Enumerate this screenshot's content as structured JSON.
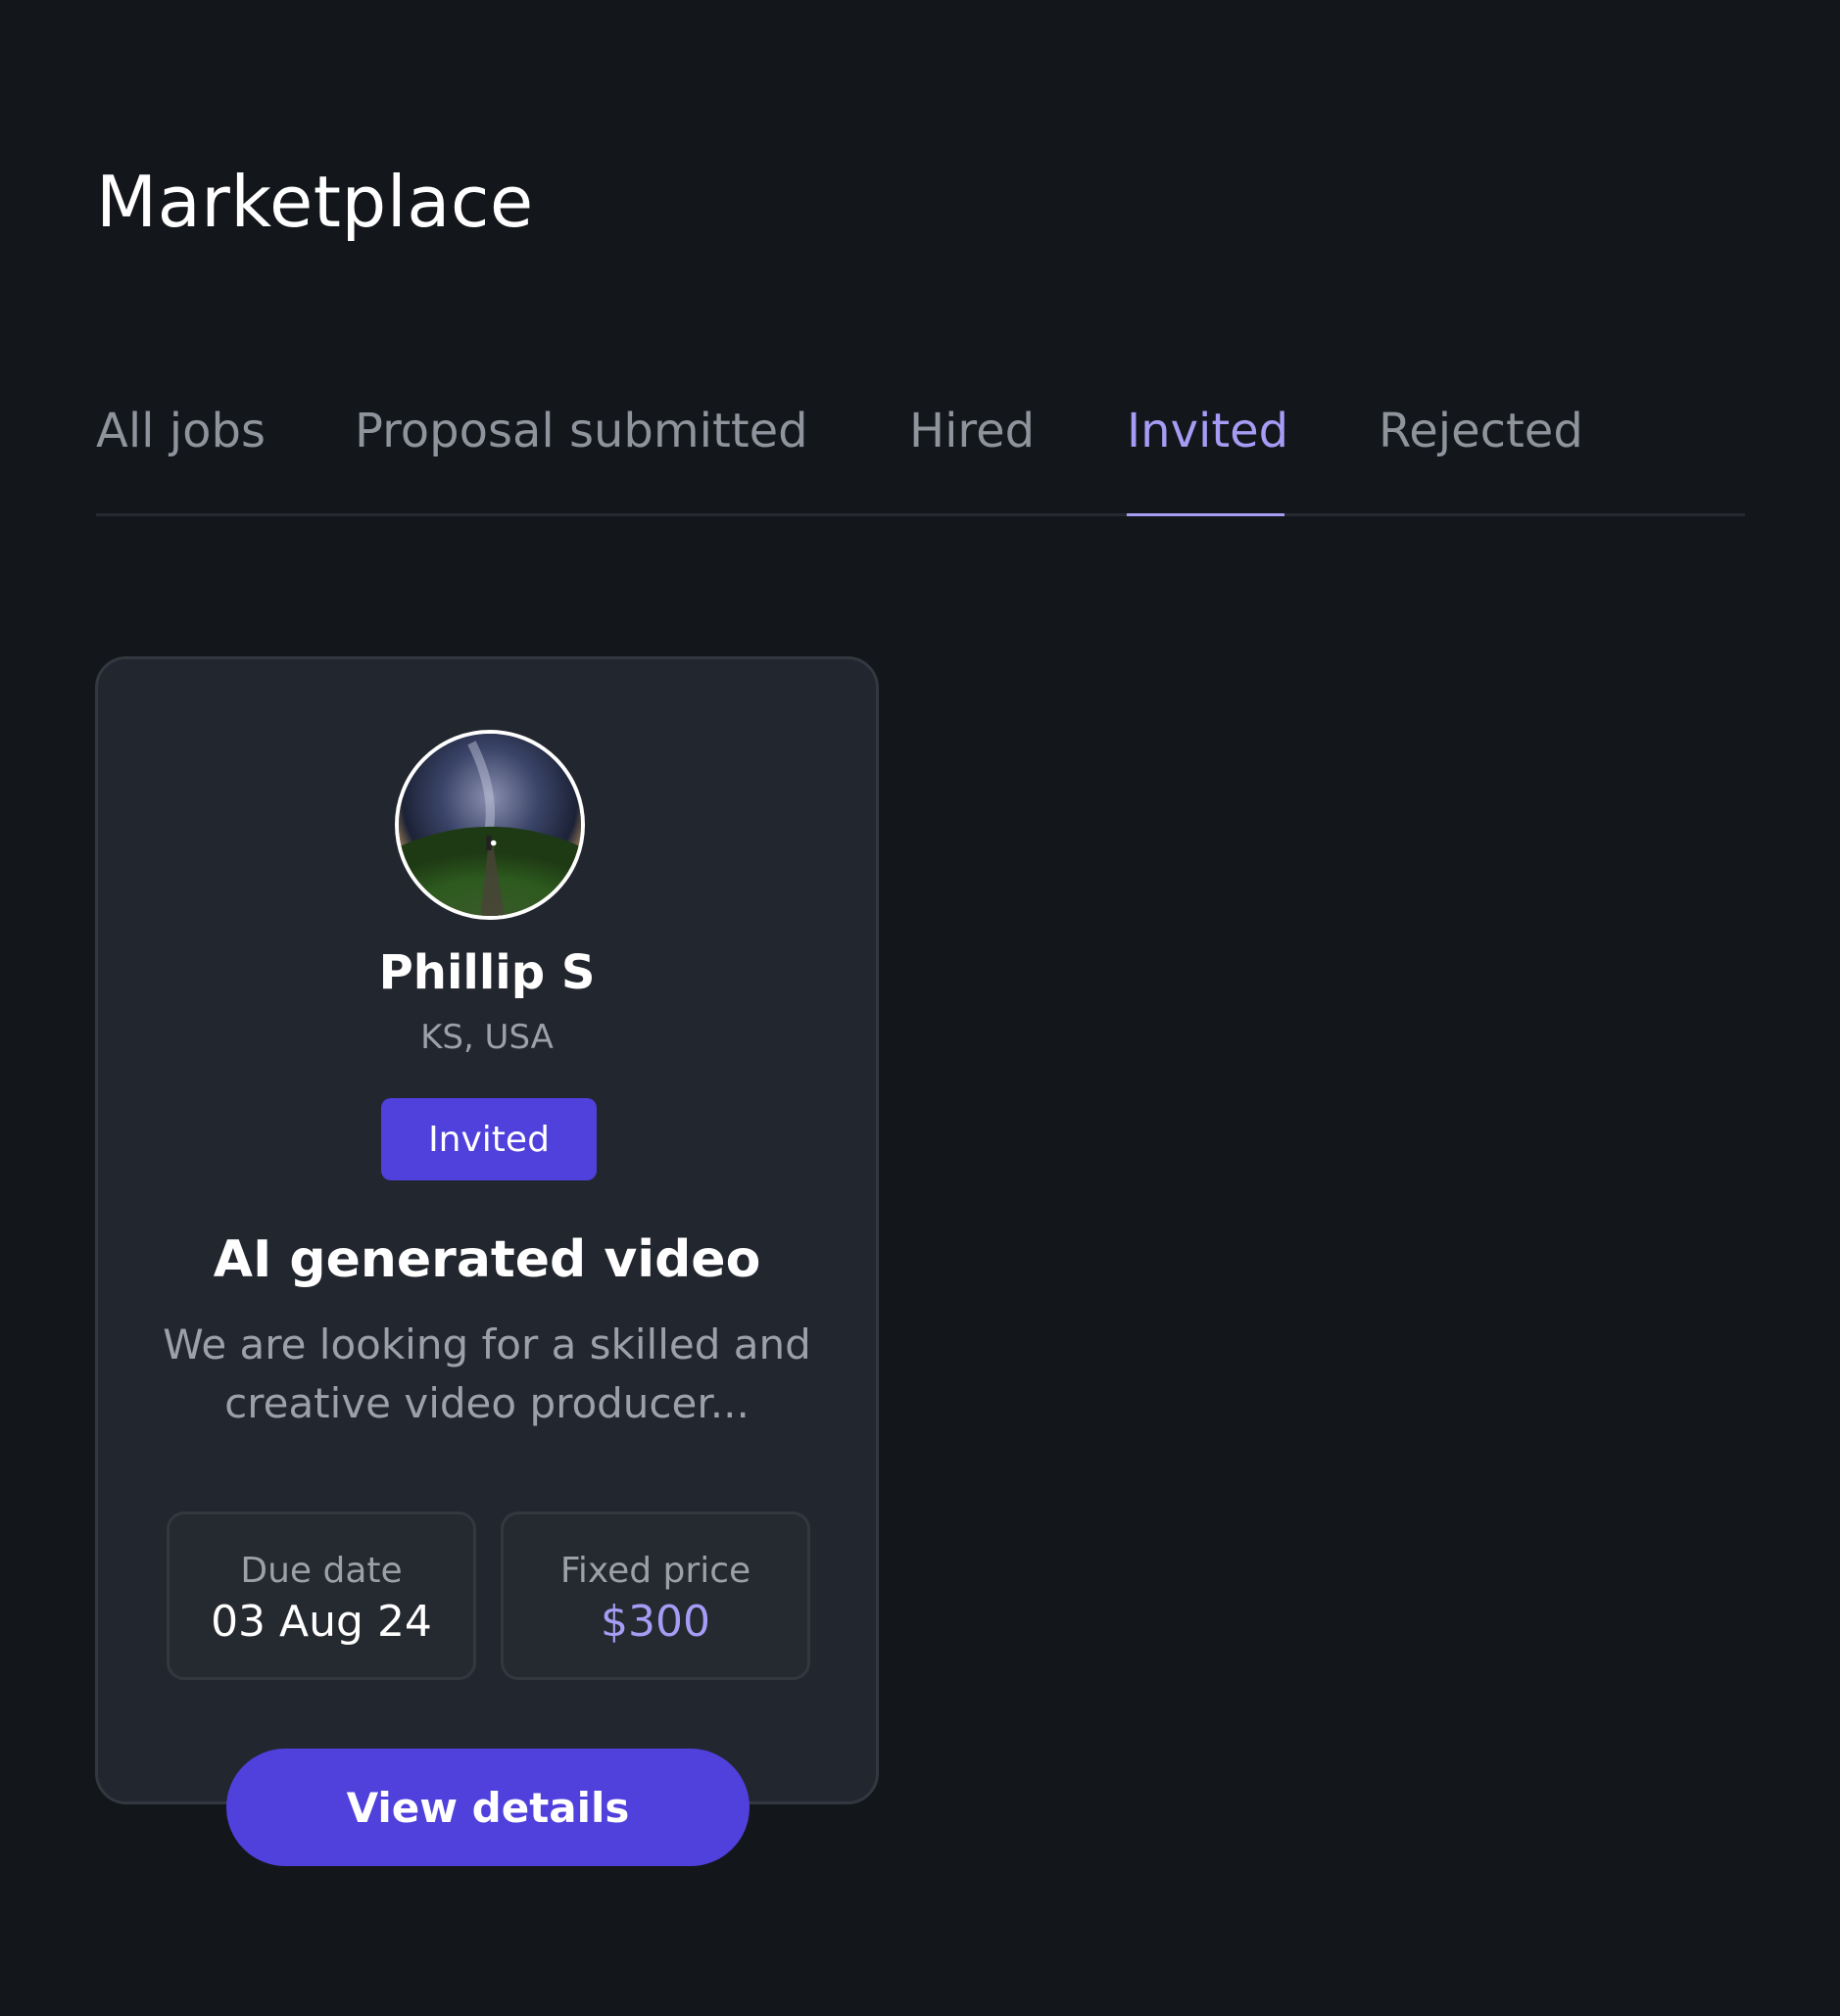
{
  "page": {
    "title": "Marketplace"
  },
  "tabs": [
    {
      "label": "All jobs",
      "active": false
    },
    {
      "label": "Proposal submitted",
      "active": false
    },
    {
      "label": "Hired",
      "active": false
    },
    {
      "label": "Invited",
      "active": true
    },
    {
      "label": "Rejected",
      "active": false
    }
  ],
  "job_card": {
    "avatar_icon": "user-avatar-photo",
    "user_name": "Phillip S",
    "location": "KS, USA",
    "status": "Invited",
    "title": "AI generated video",
    "description": "We are looking for a skilled and creative video producer...",
    "due_date_label": "Due date",
    "due_date_value": "03 Aug 24",
    "price_label": "Fixed price",
    "price_value": "$300",
    "button_label": "View details"
  },
  "colors": {
    "background": "#13161a",
    "card": "#22262e",
    "accent": "#a79cf5",
    "primary_button": "#5040dc"
  }
}
